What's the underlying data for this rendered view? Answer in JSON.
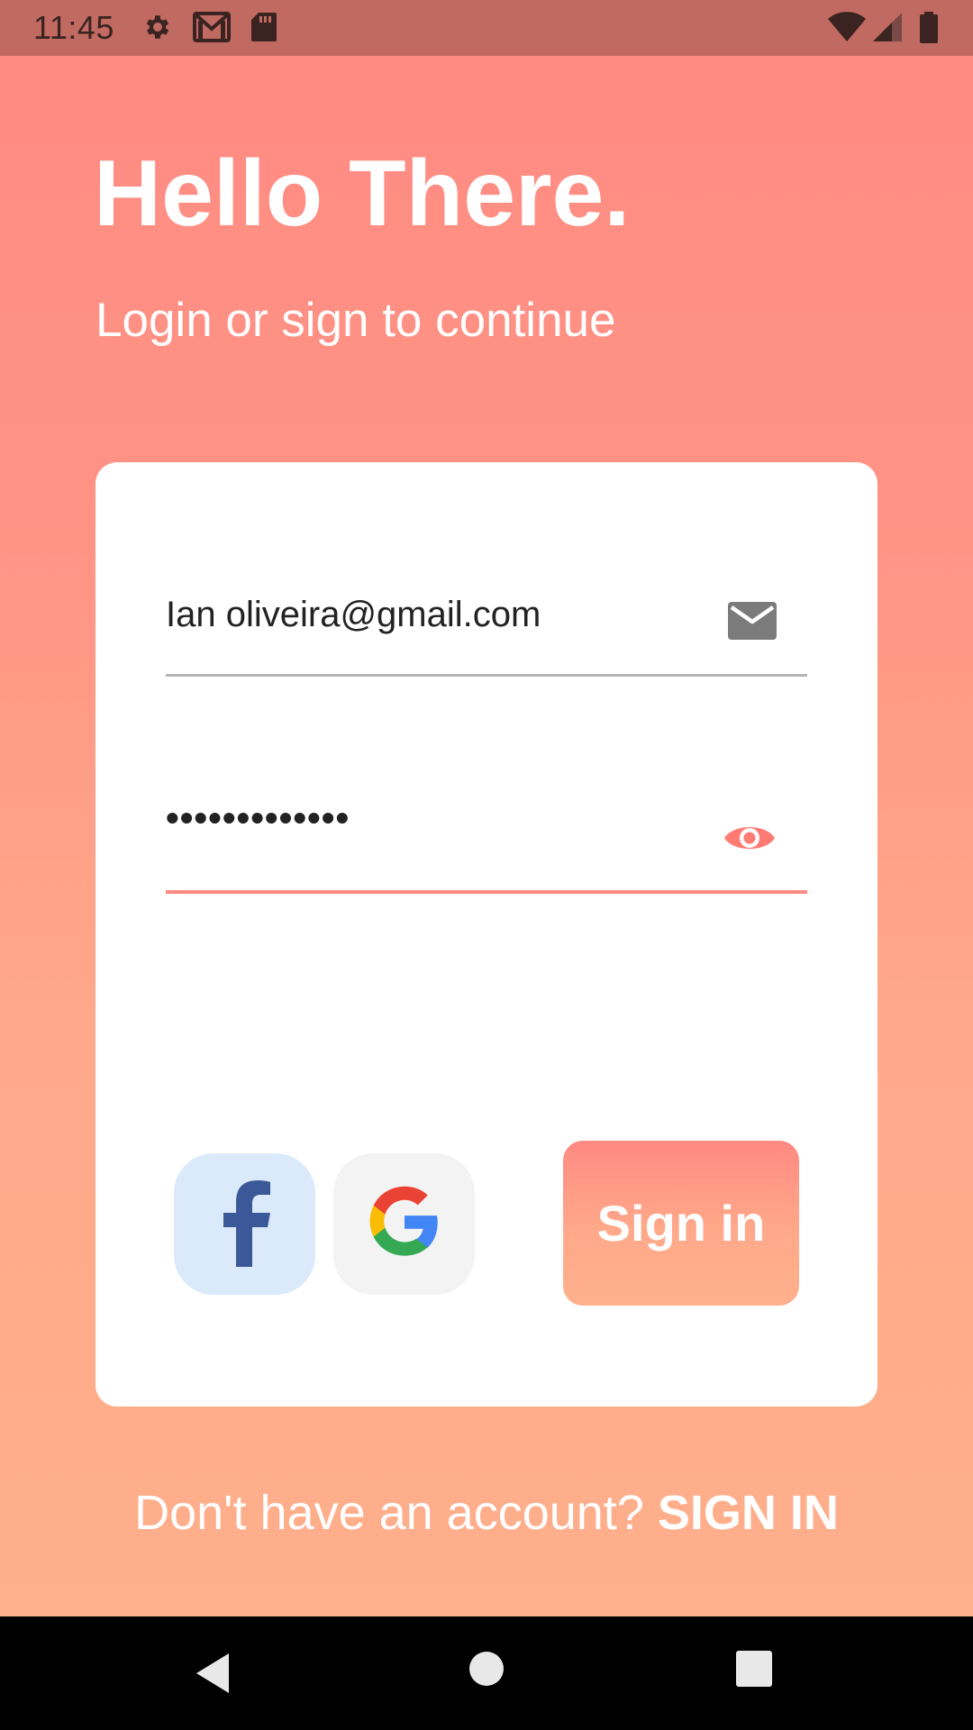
{
  "status_bar": {
    "time": "11:45",
    "icons": [
      "gear-icon",
      "gmail-icon",
      "sd-card-icon",
      "wifi-icon",
      "signal-icon",
      "battery-icon"
    ]
  },
  "header": {
    "title": "Hello There.",
    "subtitle": "Login or sign to continue"
  },
  "form": {
    "email_value": "Ian oliveira@gmail.com",
    "email_icon": "mail-icon",
    "password_value": "•••••••••••••",
    "password_icon": "eye-icon"
  },
  "social": {
    "facebook_icon": "facebook-icon",
    "google_icon": "google-icon"
  },
  "actions": {
    "sign_in_label": "Sign in"
  },
  "footer": {
    "prompt": "Don't have an account? ",
    "link": "SIGN IN"
  },
  "nav": {
    "icons": [
      "back-icon",
      "home-icon",
      "recents-icon"
    ]
  },
  "colors": {
    "accent": "#ff8a82",
    "accent_light": "#ffb08c",
    "status_bar": "#c06a62",
    "card": "#ffffff",
    "facebook_blue": "#3b5998",
    "facebook_bg": "#dbeafb"
  }
}
